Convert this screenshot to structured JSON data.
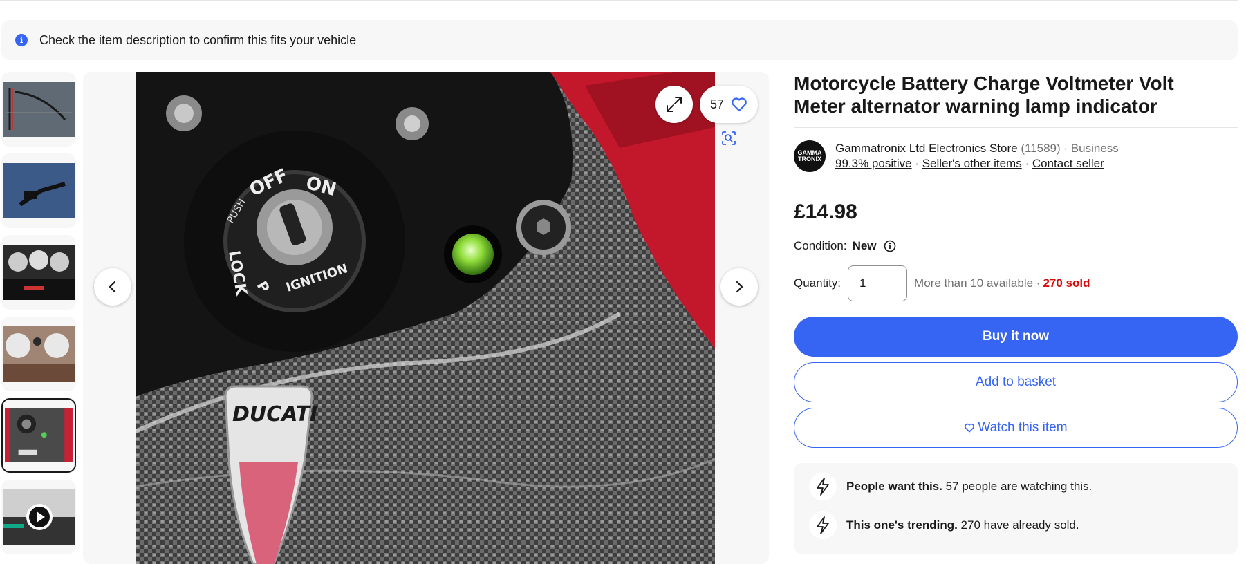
{
  "notice": {
    "text": "Check the item description to confirm this fits your vehicle",
    "icon": "info-icon"
  },
  "gallery": {
    "thumbnails": [
      {
        "name": "thumb-cable"
      },
      {
        "name": "thumb-connector"
      },
      {
        "name": "thumb-dashboard"
      },
      {
        "name": "thumb-gauges"
      },
      {
        "name": "thumb-ducati-ignition",
        "selected": true
      },
      {
        "name": "thumb-video"
      }
    ],
    "watch_count": "57",
    "photo_text": {
      "off": "OFF",
      "on": "ON",
      "push": "PUSH",
      "lock": "LOCK",
      "p": "P",
      "ignition": "IGNITION",
      "brand": "DUCATI"
    }
  },
  "item": {
    "title": "Motorcycle Battery Charge Voltmeter Volt Meter alternator warning lamp indicator",
    "price": "£14.98",
    "condition_label": "Condition:",
    "condition_value": "New",
    "quantity_label": "Quantity:",
    "quantity_value": "1",
    "availability": "More than 10 available · ",
    "sold": "270 sold"
  },
  "seller": {
    "logo_text": "GAMMA TRONIX",
    "store_name": "Gammatronix Ltd Electronics Store",
    "feedback_count": "(11589)",
    "type": "· Business",
    "positive": "99.3% positive",
    "sep": " · ",
    "other_items": "Seller's other items",
    "contact": "Contact seller"
  },
  "actions": {
    "buy_now": "Buy it now",
    "add_to_basket": "Add to basket",
    "watch": "Watch this item"
  },
  "signals": [
    {
      "bold": "People want this.",
      "rest": " 57 people are watching this."
    },
    {
      "bold": "This one's trending.",
      "rest": " 270 have already sold."
    }
  ],
  "colors": {
    "accent": "#3665f3",
    "sold_red": "#d50b0b"
  }
}
